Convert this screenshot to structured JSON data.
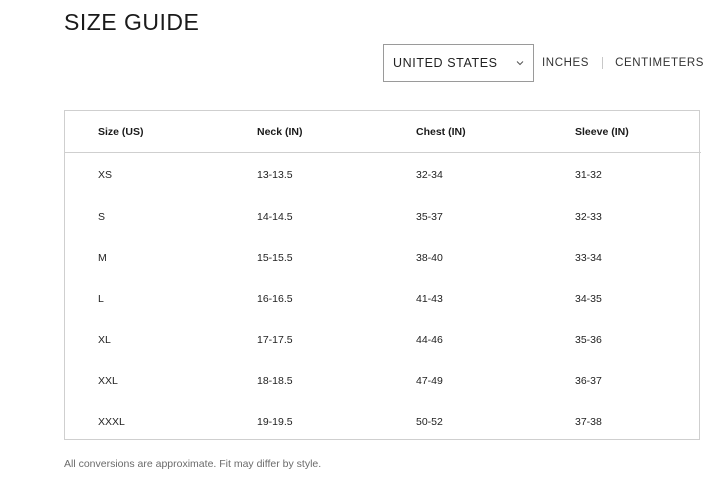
{
  "page": {
    "title": "SIZE GUIDE",
    "note": "All conversions are approximate. Fit may differ by style."
  },
  "controls": {
    "country": {
      "selected": "UNITED STATES",
      "icon": "chevron-down-icon"
    },
    "units": [
      "INCHES",
      "CENTIMETERS"
    ]
  },
  "table": {
    "headers": [
      "Size (US)",
      "Neck (IN)",
      "Chest (IN)",
      "Sleeve (IN)"
    ],
    "rows": [
      [
        "XS",
        "13-13.5",
        "32-34",
        "31-32"
      ],
      [
        "S",
        "14-14.5",
        "35-37",
        "32-33"
      ],
      [
        "M",
        "15-15.5",
        "38-40",
        "33-34"
      ],
      [
        "L",
        "16-16.5",
        "41-43",
        "34-35"
      ],
      [
        "XL",
        "17-17.5",
        "44-46",
        "35-36"
      ],
      [
        "XXL",
        "18-18.5",
        "47-49",
        "36-37"
      ],
      [
        "XXXL",
        "19-19.5",
        "50-52",
        "37-38"
      ]
    ]
  }
}
